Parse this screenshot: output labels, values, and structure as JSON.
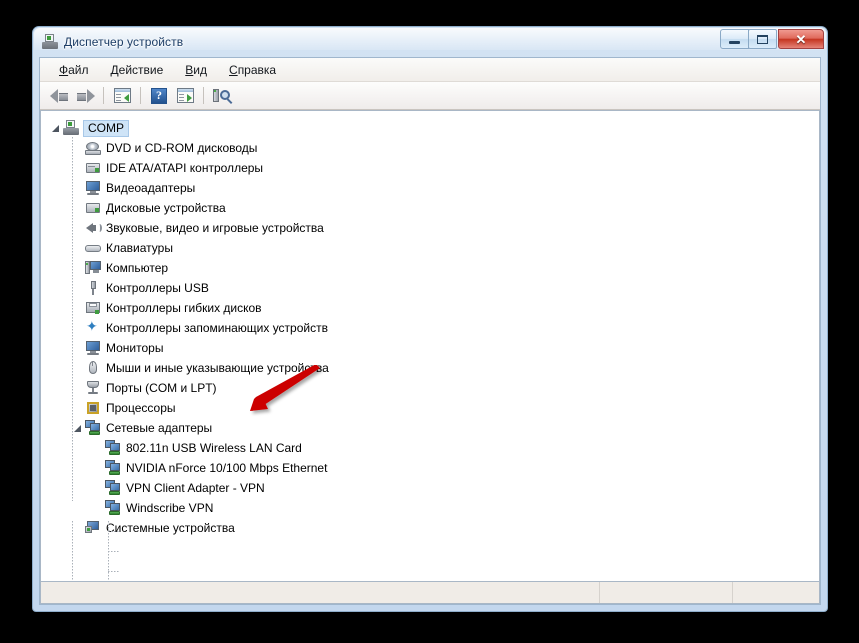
{
  "window": {
    "title": "Диспетчер устройств",
    "title_icon": "device-manager-icon",
    "buttons": {
      "minimize": "—",
      "maximize": "❐",
      "close": "✕"
    }
  },
  "menubar": {
    "items": [
      {
        "label": "Файл",
        "accesskey": "Ф",
        "rest": "айл"
      },
      {
        "label": "Действие",
        "accesskey": "Д",
        "rest": "ействие"
      },
      {
        "label": "Вид",
        "accesskey": "В",
        "rest": "ид"
      },
      {
        "label": "Справка",
        "accesskey": "С",
        "rest": "правка"
      }
    ]
  },
  "toolbar": {
    "items": [
      {
        "name": "back-button",
        "icon": "back-arrow-icon"
      },
      {
        "name": "forward-button",
        "icon": "forward-arrow-icon"
      },
      {
        "name": "show-hide-console-tree-button",
        "icon": "console-tree-icon"
      },
      {
        "name": "help-button",
        "icon": "help-question-icon",
        "glyph": "?"
      },
      {
        "name": "properties-button",
        "icon": "properties-panel-icon"
      },
      {
        "name": "scan-hardware-changes-button",
        "icon": "scan-hardware-icon"
      }
    ]
  },
  "tree": {
    "root": {
      "label": "COMP",
      "icon": "computer-root-icon",
      "state": "expanded",
      "selected": true
    },
    "nodes": [
      {
        "label": "DVD и CD-ROM дисководы",
        "icon": "dvd-drive-icon",
        "state": "collapsed"
      },
      {
        "label": "IDE ATA/ATAPI контроллеры",
        "icon": "ide-controller-icon",
        "state": "collapsed"
      },
      {
        "label": "Видеоадаптеры",
        "icon": "display-adapter-icon",
        "state": "collapsed"
      },
      {
        "label": "Дисковые устройства",
        "icon": "disk-drive-icon",
        "state": "collapsed"
      },
      {
        "label": "Звуковые, видео и игровые устройства",
        "icon": "sound-device-icon",
        "state": "collapsed"
      },
      {
        "label": "Клавиатуры",
        "icon": "keyboard-icon",
        "state": "collapsed"
      },
      {
        "label": "Компьютер",
        "icon": "computer-icon",
        "state": "collapsed"
      },
      {
        "label": "Контроллеры USB",
        "icon": "usb-controller-icon",
        "state": "collapsed"
      },
      {
        "label": "Контроллеры гибких дисков",
        "icon": "floppy-controller-icon",
        "state": "collapsed"
      },
      {
        "label": "Контроллеры запоминающих устройств",
        "icon": "storage-controller-icon",
        "state": "collapsed"
      },
      {
        "label": "Мониторы",
        "icon": "monitor-icon",
        "state": "collapsed"
      },
      {
        "label": "Мыши и иные указывающие устройства",
        "icon": "mouse-icon",
        "state": "collapsed"
      },
      {
        "label": "Порты (COM и LPT)",
        "icon": "port-icon",
        "state": "collapsed"
      },
      {
        "label": "Процессоры",
        "icon": "processor-icon",
        "state": "collapsed"
      },
      {
        "label": "Сетевые адаптеры",
        "icon": "network-adapter-icon",
        "state": "expanded"
      },
      {
        "label": "Системные устройства",
        "icon": "system-device-icon",
        "state": "collapsed"
      }
    ],
    "network_children": [
      {
        "label": "802.11n USB Wireless LAN Card",
        "icon": "network-adapter-icon"
      },
      {
        "label": "NVIDIA nForce 10/100 Mbps Ethernet",
        "icon": "network-adapter-icon"
      },
      {
        "label": "VPN Client Adapter - VPN",
        "icon": "network-adapter-icon"
      },
      {
        "label": "Windscribe VPN",
        "icon": "network-adapter-icon"
      }
    ]
  },
  "statusbar": {
    "pane1": "",
    "pane2": "",
    "pane3": ""
  },
  "annotation": {
    "type": "red-arrow",
    "color": "#cc0000",
    "points_to": "802.11n USB Wireless LAN Card"
  }
}
